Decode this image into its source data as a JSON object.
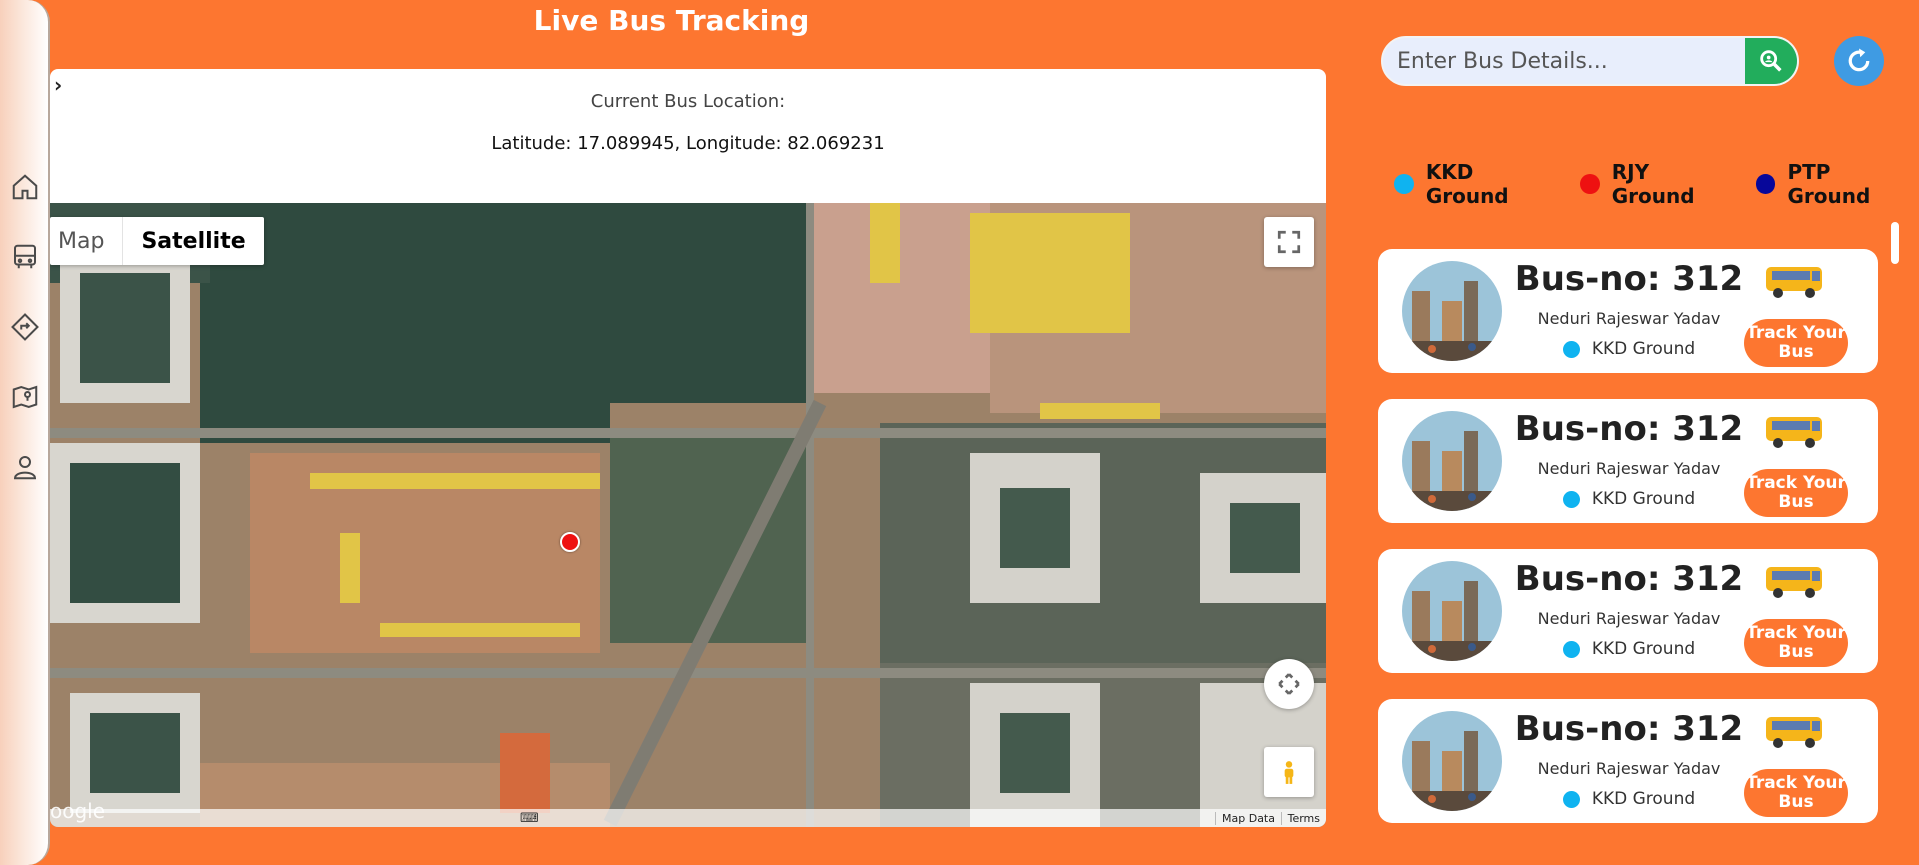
{
  "header": {
    "title": "Live Bus Tracking"
  },
  "sidebar": {
    "items": [
      {
        "icon": "home-icon"
      },
      {
        "icon": "bus-icon"
      },
      {
        "icon": "directions-icon"
      },
      {
        "icon": "map-pin-icon"
      },
      {
        "icon": "user-icon"
      }
    ]
  },
  "location": {
    "label": "Current Bus Location:",
    "coords": "Latitude: 17.089945, Longitude: 82.069231"
  },
  "map": {
    "type_map": "Map",
    "type_satellite": "Satellite",
    "selected_type": "Satellite",
    "logo": "oogle",
    "map_data": "Map Data",
    "terms": "Terms"
  },
  "search": {
    "placeholder": "Enter Bus Details..."
  },
  "legend": [
    {
      "label": "KKD Ground",
      "color": "#0fb3f0"
    },
    {
      "label": "RJY Ground",
      "color": "#ee1111"
    },
    {
      "label": "PTP Ground",
      "color": "#07079a"
    }
  ],
  "buses": [
    {
      "title": "Bus-no: 312",
      "driver": "Neduri Rajeswar Yadav",
      "ground": "KKD Ground",
      "ground_color": "#0fb3f0",
      "track_label": "Track Your Bus"
    },
    {
      "title": "Bus-no: 312",
      "driver": "Neduri Rajeswar Yadav",
      "ground": "KKD Ground",
      "ground_color": "#0fb3f0",
      "track_label": "Track Your Bus"
    },
    {
      "title": "Bus-no: 312",
      "driver": "Neduri Rajeswar Yadav",
      "ground": "KKD Ground",
      "ground_color": "#0fb3f0",
      "track_label": "Track Your Bus"
    },
    {
      "title": "Bus-no: 312",
      "driver": "Neduri Rajeswar Yadav",
      "ground": "KKD Ground",
      "ground_color": "#0fb3f0",
      "track_label": "Track Your Bus"
    }
  ],
  "colors": {
    "accent": "#fd7630",
    "search_button": "#22ad5c",
    "refresh_button": "#3f9be3"
  }
}
